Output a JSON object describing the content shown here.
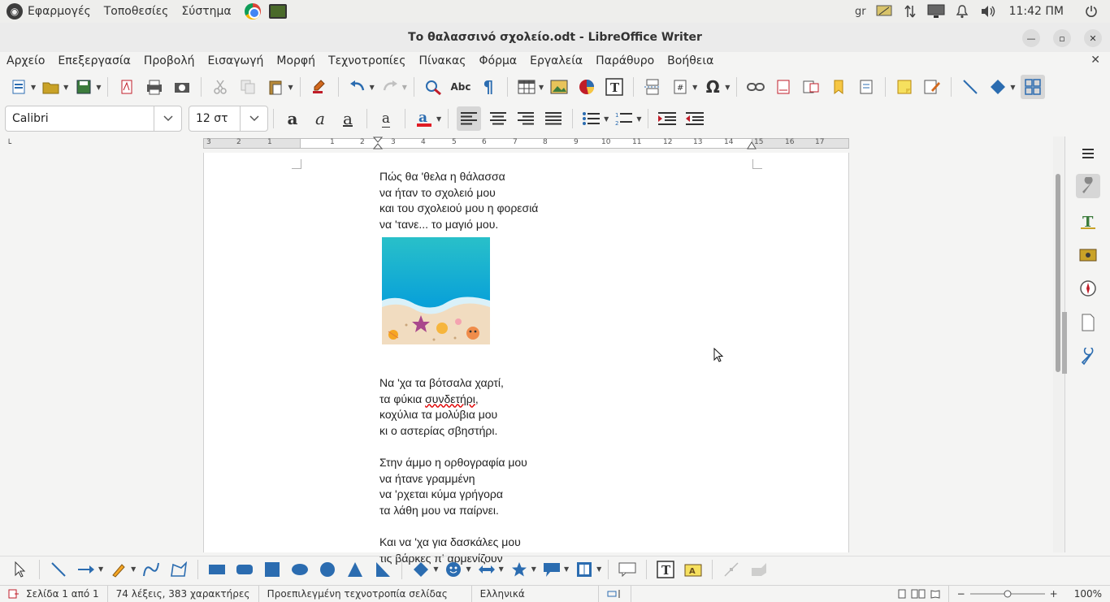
{
  "topbar": {
    "menus": [
      "Εφαρμογές",
      "Τοποθεσίες",
      "Σύστημα"
    ],
    "keyboard_layout": "gr",
    "clock": "11:42 ΠΜ",
    "tray_icons": [
      "display-icon",
      "network-icon",
      "monitor-icon",
      "bell-icon",
      "volume-icon",
      "power-icon"
    ]
  },
  "window": {
    "title": "Το θαλασσινό σχολείο.odt - LibreOffice Writer",
    "buttons": [
      "minimize",
      "maximize",
      "close"
    ]
  },
  "menubar": {
    "items": [
      "Αρχείο",
      "Επεξεργασία",
      "Προβολή",
      "Εισαγωγή",
      "Μορφή",
      "Τεχνοτροπίες",
      "Πίνακας",
      "Φόρμα",
      "Εργαλεία",
      "Παράθυρο",
      "Βοήθεια"
    ]
  },
  "formatting": {
    "font_name": "Calibri",
    "font_size": "12 στ"
  },
  "document": {
    "stanzas": [
      [
        "Πώς θα 'θελα η θάλασσα",
        "να ήταν το σχολειό μου",
        "και του σχολειού μου η φορεσιά",
        "να 'τανε... το μαγιό μου."
      ],
      [
        "Να 'χα τα βότσαλα χαρτί,",
        "τα φύκια συνδετήρι,",
        "κοχύλια τα μολύβια μου",
        "κι ο αστερίας σβηστήρι."
      ],
      [
        "Στην άμμο η ορθογραφία μου",
        "να ήτανε γραμμένη",
        "να 'ρχεται κύμα γρήγορα",
        "τα λάθη μου να παίρνει."
      ],
      [
        "Και να 'χα για δασκάλες μου",
        "τις βάρκες π' αρμενίζουν"
      ]
    ],
    "image_alt": "sea-and-beach-illustration",
    "misspelled_word": "συνδετήρι"
  },
  "ruler": {
    "left_numbers": [
      "3",
      "2",
      "1"
    ],
    "numbers": [
      "1",
      "2",
      "3",
      "4",
      "5",
      "6",
      "7",
      "8",
      "9",
      "10",
      "11",
      "12",
      "13",
      "14",
      "15",
      "16",
      "17"
    ]
  },
  "statusbar": {
    "page": "Σελίδα 1 από 1",
    "words": "74 λέξεις, 383 χαρακτήρες",
    "page_style": "Προεπιλεγμένη τεχνοτροπία σελίδας",
    "language": "Ελληνικά",
    "zoom": "100%"
  },
  "colors": {
    "sea_top": "#1fb8c8",
    "sea_deep": "#0a9bd6",
    "sand": "#f1dcc0",
    "font_color": "#e01b24",
    "highlight_button": "#d6d6d6"
  }
}
